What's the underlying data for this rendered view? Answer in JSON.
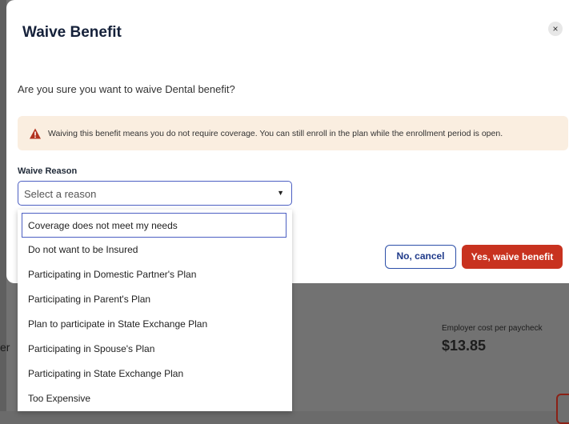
{
  "background": {
    "fragment": "er",
    "employer_cost_label": "Employer cost per paycheck",
    "employer_cost_value": "$13.85"
  },
  "modal": {
    "title": "Waive Benefit",
    "close_label": "×",
    "question": "Are you sure you want to waive Dental benefit?",
    "alert_icon": "warning-triangle-icon",
    "alert_text": "Waiving this benefit means you do not require coverage. You can still enroll in the plan while the enrollment period is open.",
    "reason_label": "Waive Reason",
    "select_placeholder": "Select a reason",
    "cancel_label": "No, cancel",
    "confirm_label": "Yes, waive benefit"
  },
  "dropdown": {
    "options": [
      "Coverage does not meet my needs",
      "Do not want to be Insured",
      "Participating in Domestic Partner's Plan",
      "Participating in Parent's Plan",
      "Plan to participate in State Exchange Plan",
      "Participating in Spouse's Plan",
      "Participating in State Exchange Plan",
      "Too Expensive"
    ]
  },
  "colors": {
    "accent_blue": "#4c5fc2",
    "danger_red": "#c8321f",
    "alert_bg": "#faeee0"
  }
}
